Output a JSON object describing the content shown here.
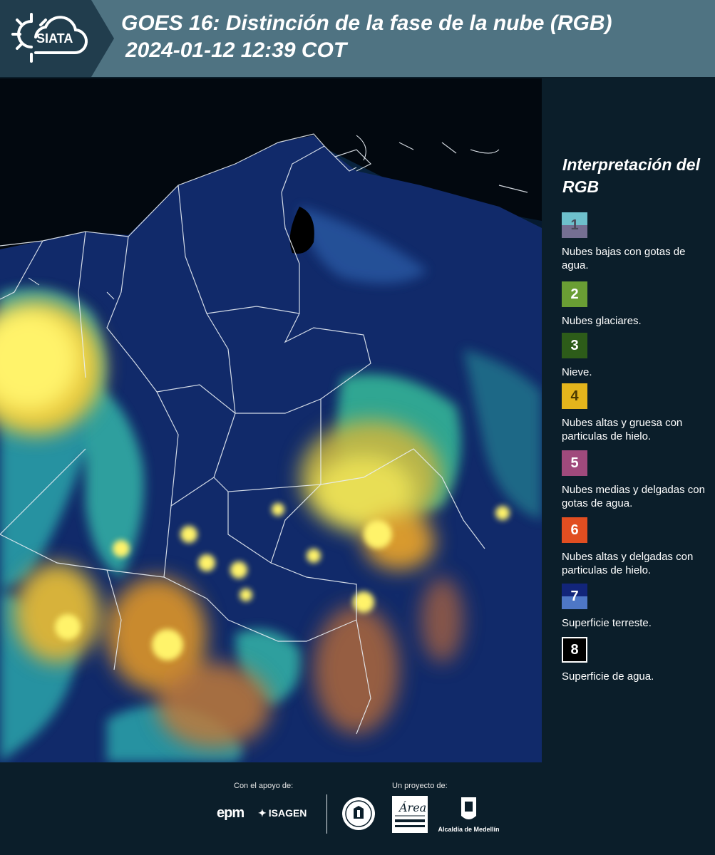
{
  "header": {
    "logo_text": "SIATA",
    "title_line1": "GOES 16: Distinción de la fase de la nube (RGB)",
    "title_line2": "2024-01-12 12:39 COT"
  },
  "legend": {
    "title": "Interpretación del RGB",
    "items": [
      {
        "number": "1",
        "label": "Nubes bajas con gotas de agua.",
        "color": "#6ec0cc"
      },
      {
        "number": "2",
        "label": "Nubes glaciares.",
        "color": "#6a9e34"
      },
      {
        "number": "3",
        "label": "Nieve.",
        "color": "#2d5c19"
      },
      {
        "number": "4",
        "label": "Nubes altas y gruesa con particulas de hielo.",
        "color": "#e4b51c"
      },
      {
        "number": "5",
        "label": "Nubes medias y delgadas con gotas de agua.",
        "color": "#a04a7c"
      },
      {
        "number": "6",
        "label": "Nubes altas y delgadas con particulas de hielo.",
        "color": "#e14e21"
      },
      {
        "number": "7",
        "label": "Superficie terreste.",
        "color": "#12257a"
      },
      {
        "number": "8",
        "label": "Superficie de agua.",
        "color": "#000000"
      }
    ]
  },
  "footer": {
    "support_label": "Con el apoyo de:",
    "project_label": "Un proyecto de:",
    "sponsor1": "epm",
    "sponsor2": "ISAGEN",
    "partner_metro": "Área METROPOLITANA Valle de Aburrá",
    "partner_alcaldia": "Alcaldía de Medellín"
  }
}
